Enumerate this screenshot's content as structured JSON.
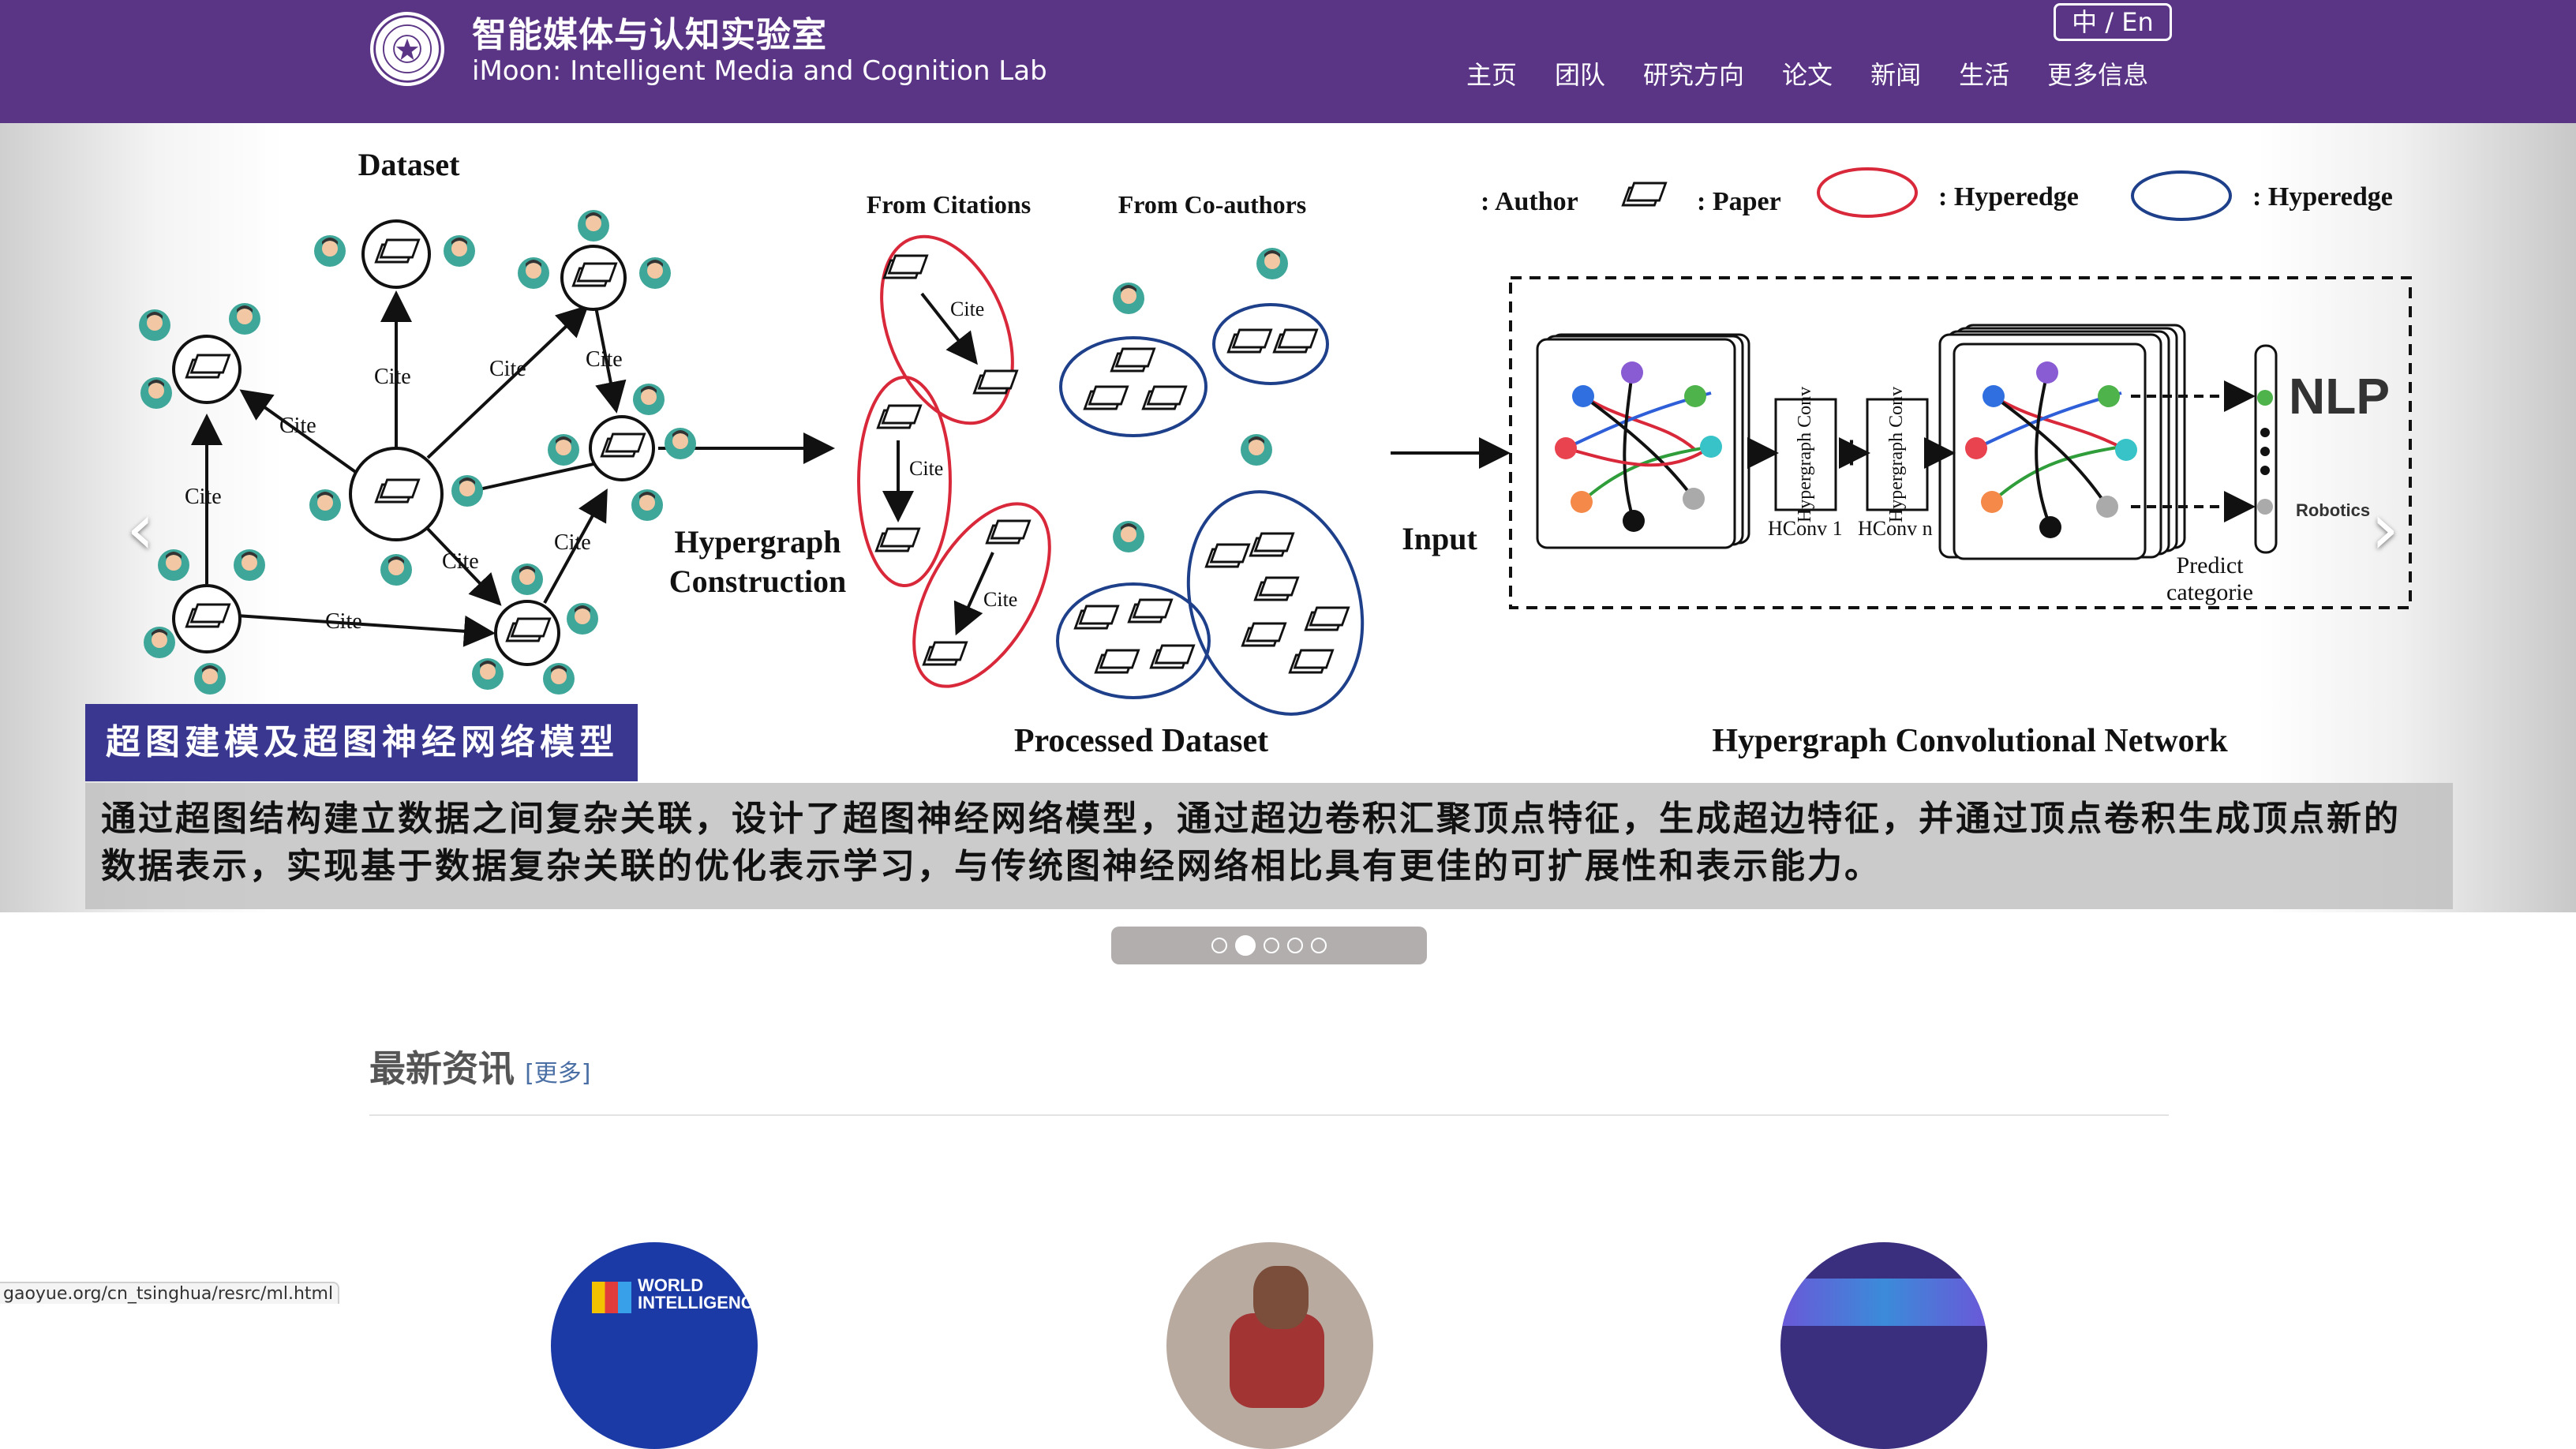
{
  "header": {
    "lab_title": "智能媒体与认知实验室",
    "lab_subtitle": "iMoon: Intelligent Media and Cognition Lab",
    "lang_toggle": "中 / En",
    "nav": [
      "主页",
      "团队",
      "研究方向",
      "论文",
      "新闻",
      "生活",
      "更多信息"
    ]
  },
  "carousel": {
    "figure": {
      "dataset_title": "Dataset",
      "cite": "Cite",
      "construction": [
        "Hypergraph",
        "Construction"
      ],
      "from_citations": "From Citations",
      "from_coauthors": "From Co-authors",
      "processed_dataset": "Processed Dataset",
      "legend": {
        "author": ": Author",
        "paper": ": Paper",
        "hyperedge_red": ": Hyperedge",
        "hyperedge_blue": ": Hyperedge"
      },
      "input": "Input",
      "conv_label": "Hypergraph Conv",
      "hconv1": "HConv 1",
      "hconvn": "HConv n",
      "predict": [
        "Predict",
        "categorie"
      ],
      "nlp": "NLP",
      "robotics": "Robotics",
      "hgcn_title": "Hypergraph Convolutional Network"
    },
    "caption_title": "超图建模及超图神经网络模型",
    "caption_body": "通过超图结构建立数据之间复杂关联，设计了超图神经网络模型，通过超边卷积汇聚顶点特征，生成超边特征，并通过顶点卷积生成顶点新的数据表示，实现基于数据复杂关联的优化表示学习，与传统图神经网络相比具有更佳的可扩展性和表示能力。",
    "arrow_left": "‹",
    "arrow_right": "›",
    "slide_count": 5,
    "active_slide": 2
  },
  "news": {
    "title": "最新资讯",
    "more": "[更多]",
    "thumb1_text": "WORLD\nINTELLIGENCE"
  },
  "statusbar": {
    "url": "gaoyue.org/cn_tsinghua/resrc/ml.html"
  },
  "colors": {
    "header_bg": "#5b3585",
    "caption_title_bg": "#3a3790",
    "hyperedge_red": "#d8283a",
    "hyperedge_blue": "#1e3f8a"
  }
}
